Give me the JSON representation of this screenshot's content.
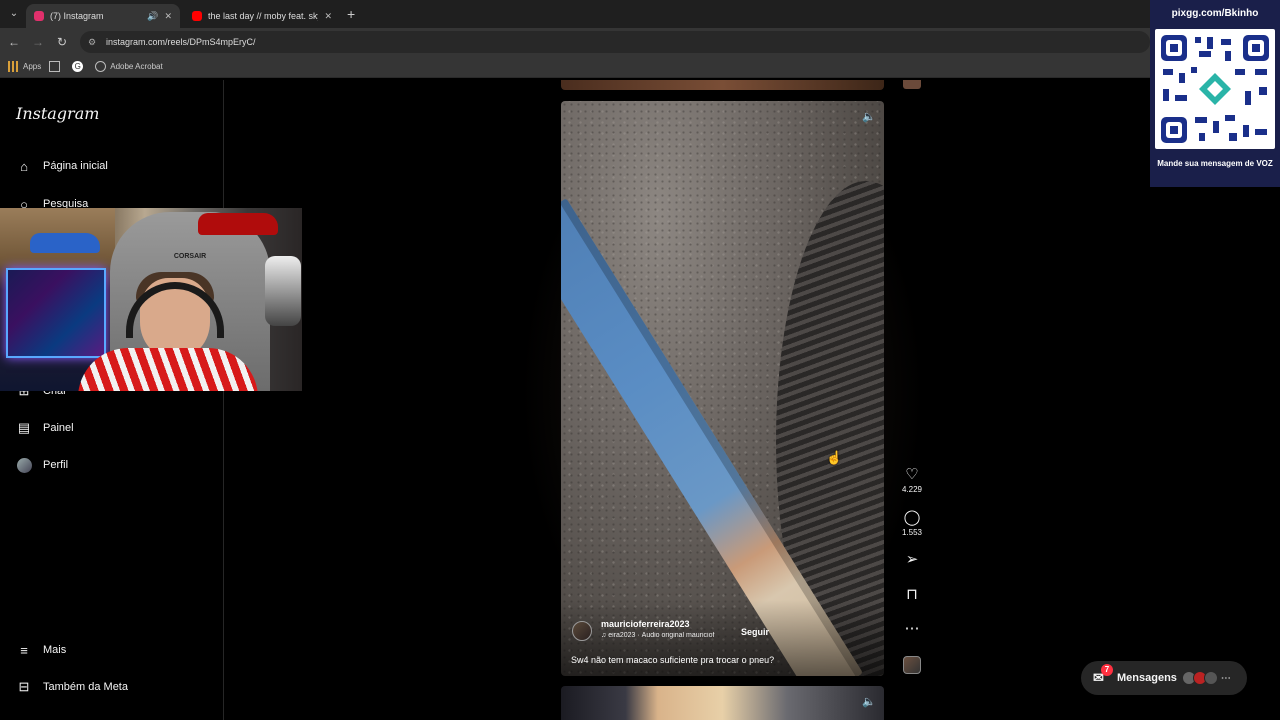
{
  "browser": {
    "tabs": [
      {
        "title": "(7) Instagram",
        "favicon_color": "#e1306c",
        "active": true
      },
      {
        "title": "the last day // moby feat. skylar",
        "favicon_color": "#ff0000",
        "active": false
      }
    ],
    "new_tab": "+",
    "url": "instagram.com/reels/DPmS4mpEryC/",
    "bookmarks": [
      {
        "label": "Apps",
        "icon": "apps-grid-icon"
      },
      {
        "label": "",
        "icon": "grid-icon"
      },
      {
        "label": "",
        "icon": "google-icon"
      },
      {
        "label": "Adobe Acrobat",
        "icon": "acrobat-icon"
      }
    ]
  },
  "sidebar": {
    "logo": "Instagram",
    "items": [
      {
        "label": "Página inicial",
        "icon": "home-icon"
      },
      {
        "label": "Pesquisa",
        "icon": "search-icon"
      },
      {
        "label": "Criar",
        "icon": "create-icon"
      },
      {
        "label": "Painel",
        "icon": "dashboard-icon"
      },
      {
        "label": "Perfil",
        "icon": "profile-avatar-icon"
      }
    ],
    "bottom": [
      {
        "label": "Mais",
        "icon": "menu-icon"
      },
      {
        "label": "Também da Meta",
        "icon": "meta-icon"
      }
    ]
  },
  "webcam": {
    "chair_brand": "CORSAIR"
  },
  "reel": {
    "username": "mauricioferreira2023",
    "follow": "Seguir",
    "audio": "eira2023 · Áudio original  mauriciof",
    "caption": "Sw4 não tem macaco suficiente pra trocar o pneu?",
    "actions": {
      "likes": "4.229",
      "comments": "1.553"
    }
  },
  "messages": {
    "label": "Mensagens",
    "badge": "7"
  },
  "overlay": {
    "url": "pixgg.com/Bkinho",
    "message": "Mande sua mensagem de VOZ"
  },
  "colors": {
    "accent": "#ff3040",
    "overlay_bg": "#1a1f4a",
    "sidebar_border": "#262626"
  }
}
